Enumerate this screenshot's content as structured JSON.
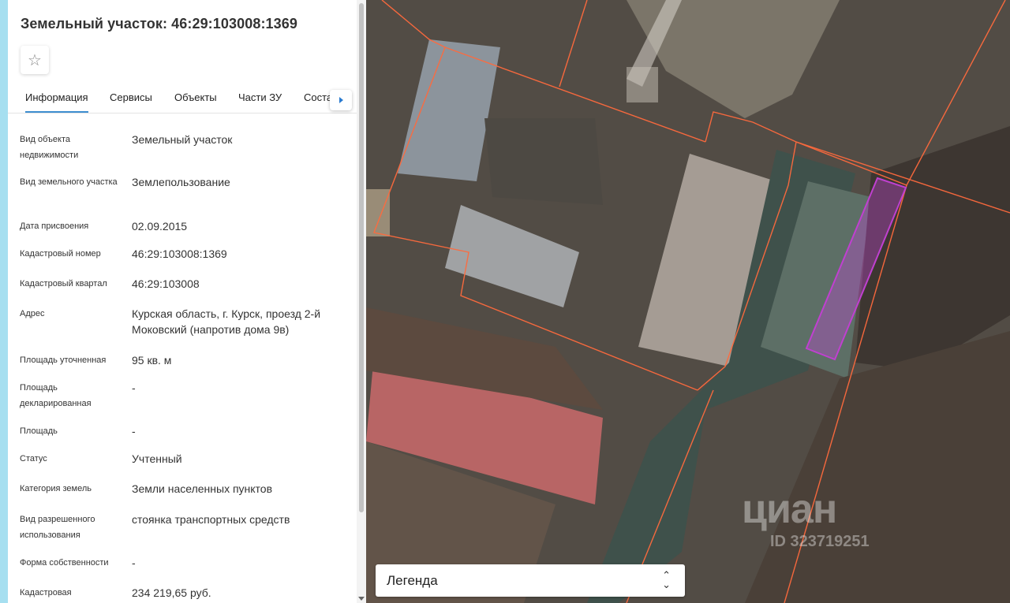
{
  "panel": {
    "title": "Земельный участок: 46:29:103008:1369",
    "favorite_icon": "star-icon"
  },
  "tabs": [
    {
      "label": "Информация",
      "active": true
    },
    {
      "label": "Сервисы"
    },
    {
      "label": "Объекты"
    },
    {
      "label": "Части ЗУ"
    },
    {
      "label": "Состав"
    }
  ],
  "tab_more_icon": "triangle-right-icon",
  "details": [
    {
      "label": "Вид объекта недвижимости",
      "value": "Земельный участок"
    },
    {
      "label": "Вид земельного участка",
      "value": "Землепользование"
    },
    {
      "label": "Дата присвоения",
      "value": "02.09.2015"
    },
    {
      "label": "Кадастровый номер",
      "value": "46:29:103008:1369"
    },
    {
      "label": "Кадастровый квартал",
      "value": "46:29:103008"
    },
    {
      "label": "Адрес",
      "value": "Курская область, г. Курск, проезд 2-й Моковский (напротив дома 9в)"
    },
    {
      "label": "Площадь уточненная",
      "value": "95 кв. м"
    },
    {
      "label": "Площадь декларированная",
      "value": "-"
    },
    {
      "label": "Площадь",
      "value": "-"
    },
    {
      "label": "Статус",
      "value": "Учтенный"
    },
    {
      "label": "Категория земель",
      "value": "Земли населенных пунктов"
    },
    {
      "label": "Вид разрешенного использования",
      "value": "стоянка транспортных средств"
    },
    {
      "label": "Форма собственности",
      "value": "-"
    },
    {
      "label": "Кадастровая",
      "value": "234 219,65 руб."
    }
  ],
  "legend": {
    "label": "Легенда",
    "icon": "chevron-up-down-icon"
  },
  "watermark": {
    "logo": "циан",
    "id": "ID 323719251"
  },
  "colors": {
    "accent": "#3e8ed0",
    "boundary": "#e8623c",
    "highlight": "#c040d0"
  }
}
